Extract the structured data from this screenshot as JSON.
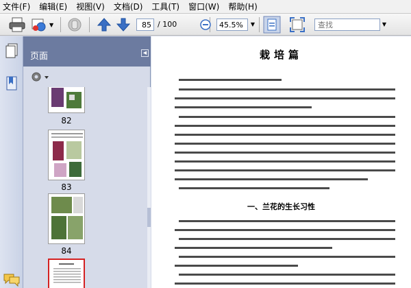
{
  "menu": [
    {
      "label": "文件(F)"
    },
    {
      "label": "编辑(E)"
    },
    {
      "label": "视图(V)"
    },
    {
      "label": "文档(D)"
    },
    {
      "label": "工具(T)"
    },
    {
      "label": "窗口(W)"
    },
    {
      "label": "帮助(H)"
    }
  ],
  "toolbar": {
    "page_current": "85",
    "page_total": "/ 100",
    "zoom": "45.5%",
    "search_placeholder": "查找"
  },
  "panel": {
    "title": "页面"
  },
  "thumbnails": [
    {
      "label": "82"
    },
    {
      "label": "83"
    },
    {
      "label": "84"
    },
    {
      "label": ""
    }
  ],
  "document": {
    "title": "栽培篇",
    "paragraphs": [
      "这里将兰花分为栽培系三种栽培精品兰两类。",
      "我们兰花栽培量较高，在栽培方面的兰花是主要的，兰花是一般品种栽培较多的。可以开花欣赏的品种，兰花不分好兰花，多为观赏品种。"
    ],
    "section_title": "一、兰花的生长习性"
  },
  "colors": {
    "panel_header": "#6c7ba0",
    "accent_blue": "#3a6fc4",
    "thumb_selected": "#d42020"
  }
}
